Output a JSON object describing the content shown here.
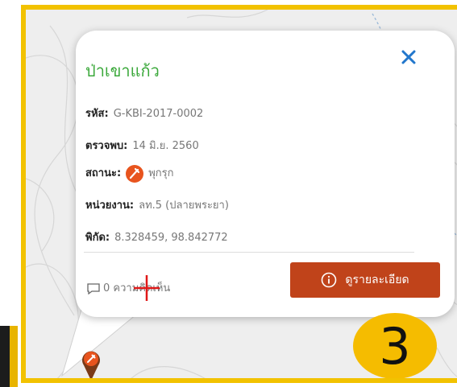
{
  "popup": {
    "title": "ป่าเขาแก้ว",
    "code_label": "รหัส:",
    "code_value": "G-KBI-2017-0002",
    "inspected_label": "ตรวจพบ:",
    "inspected_value": "14 มิ.ย. 2560",
    "status_label": "สถานะ:",
    "status_value": "พุกรุก",
    "agency_label": "หน่วยงาน:",
    "agency_value": "ลท.5 (ปลายพระยา)",
    "coord_label": "พิกัด:",
    "coord_value": "8.328459, 98.842772",
    "comments": "0 ความคิดเห็น",
    "details_button": "ดูรายละเอียด"
  },
  "badge": {
    "number": "3"
  },
  "colors": {
    "title": "#3aa83a",
    "button": "#c0431a",
    "frame": "#f2c200",
    "status": "#e8541e",
    "close": "#2277cc",
    "crosshair": "#e01818"
  },
  "icons": [
    "close-icon",
    "status-icon",
    "comment-icon",
    "info-icon",
    "crosshair-icon",
    "map-pin-icon"
  ]
}
